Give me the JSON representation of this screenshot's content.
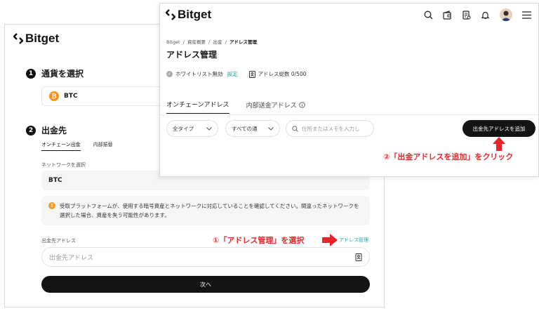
{
  "back": {
    "logo": "Bitget",
    "step1": {
      "num": "1",
      "title": "通貨を選択"
    },
    "coin": {
      "symbol": "BTC",
      "icon": "bitcoin-icon"
    },
    "step2": {
      "num": "2",
      "title": "出金先"
    },
    "tabs": [
      "オンチェーン出金",
      "内部振替"
    ],
    "network_label": "ネットワークを選択",
    "network_value": "BTC",
    "warning": "受取プラットフォームが、使用する暗号資産とネットワークに対応していることを確認してください。間違ったネットワークを選択した場合、資産を失う可能性があります。",
    "address_label": "出金先アドレス",
    "address_mgmt_link": "アドレス管理",
    "address_placeholder": "出金先アドレス",
    "next_button": "次へ",
    "annotation": "①「アドレス管理」を選択"
  },
  "front": {
    "logo": "Bitget",
    "breadcrumb": [
      "Bitget",
      "資産概要",
      "出金",
      "アドレス管理"
    ],
    "breadcrumb_sep": "/",
    "title": "アドレス管理",
    "whitelist": "ホワイトリスト無効",
    "settings": "設定",
    "total": "アドレス総数 0/500",
    "tabs": [
      "オンチェーンアドレス",
      "内部送金アドレス"
    ],
    "filter_type": "全タイプ",
    "filter_net": "すべての通",
    "search_placeholder": "住所またはメモを入力し",
    "add_button": "出金先アドレスを追加",
    "annotation": "②「出金アドレスを追加」をクリック"
  },
  "colors": {
    "accent": "#1fa3a3",
    "annotation": "#e8242b",
    "dark": "#141414",
    "btc": "#f7931a"
  }
}
